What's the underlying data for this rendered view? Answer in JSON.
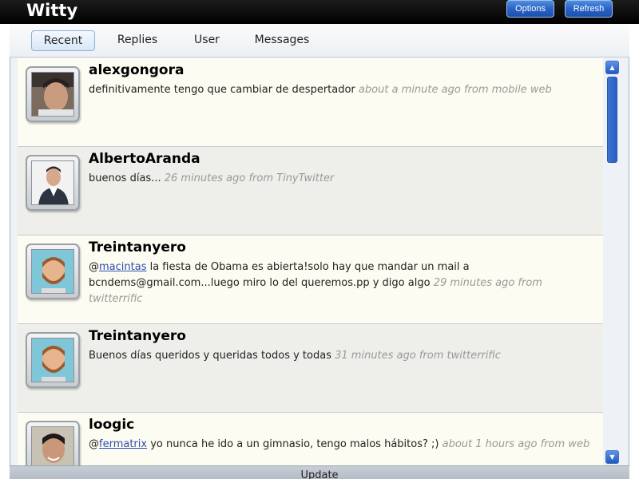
{
  "app": {
    "title": "Witty",
    "options_label": "Options",
    "refresh_label": "Refresh",
    "update_label": "Update"
  },
  "tabs": [
    {
      "label": "Recent",
      "active": true
    },
    {
      "label": "Replies",
      "active": false
    },
    {
      "label": "User",
      "active": false
    },
    {
      "label": "Messages",
      "active": false
    }
  ],
  "tweets": [
    {
      "user": "alexgongora",
      "before": "definitivamente tengo que cambiar de despertador",
      "mention": "",
      "after": "",
      "meta": "about a minute ago from mobile web",
      "avatar": "photo-man-dark-hair"
    },
    {
      "user": "AlbertoAranda",
      "before": "buenos días...",
      "mention": "",
      "after": "",
      "meta": "26 minutes ago from TinyTwitter",
      "avatar": "photo-man-suit"
    },
    {
      "user": "Treintanyero",
      "before": "@",
      "mention": "macintas",
      "after": " la fiesta de Obama es abierta!solo hay que mandar un mail a bcndems@gmail.com...luego miro lo del queremos.pp y digo algo",
      "meta": "29 minutes ago from twitterrific",
      "avatar": "cartoon-bearded-man"
    },
    {
      "user": "Treintanyero",
      "before": "Buenos días queridos y queridas todos y todas",
      "mention": "",
      "after": "",
      "meta": "31 minutes ago from twitterrific",
      "avatar": "cartoon-bearded-man"
    },
    {
      "user": "loogic",
      "before": "@",
      "mention": "fermatrix",
      "after": " yo nunca he ido a un gimnasio, tengo malos hábitos? ;)",
      "meta": "about 1 hours ago from web",
      "avatar": "photo-man-smiling"
    }
  ],
  "colors": {
    "accent": "#2a63c6",
    "meta_text": "#999999",
    "link": "#2a4fb3"
  }
}
